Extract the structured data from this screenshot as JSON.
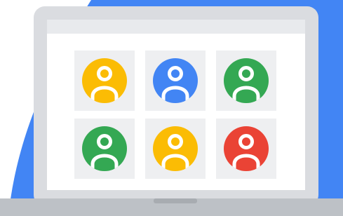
{
  "illustration": {
    "subject": "laptop-video-call-grid",
    "colors": {
      "background_blob": "#4285F4",
      "laptop_body": "#DADCE0",
      "laptop_base": "#BDC1C6",
      "screen_frame": "#E8EAED",
      "screen": "#FFFFFF",
      "tile": "#EEEFF1",
      "hinge_notch": "#A8ACB1",
      "avatar_figure": "#FFFFFF"
    },
    "participants": [
      {
        "color_name": "yellow",
        "color": "#FBBC04"
      },
      {
        "color_name": "blue",
        "color": "#4285F4"
      },
      {
        "color_name": "green",
        "color": "#34A853"
      },
      {
        "color_name": "green",
        "color": "#34A853"
      },
      {
        "color_name": "yellow",
        "color": "#FBBC04"
      },
      {
        "color_name": "red",
        "color": "#EA4335"
      }
    ]
  }
}
